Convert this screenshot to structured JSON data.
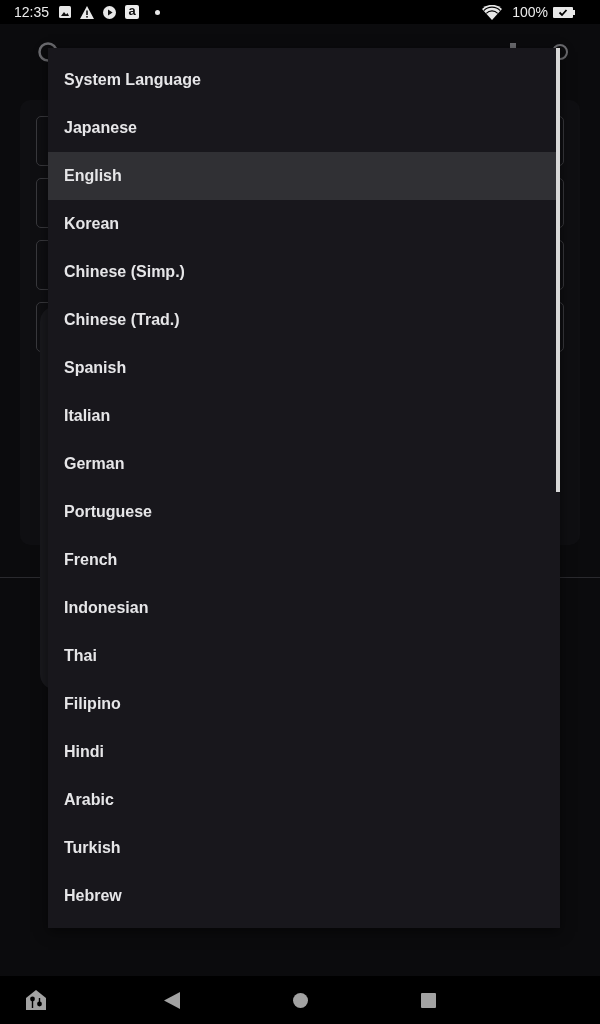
{
  "status_bar": {
    "time": "12:35",
    "app_badge": "a",
    "battery": "100%"
  },
  "language_menu": {
    "items": [
      {
        "label": "System Language",
        "selected": false
      },
      {
        "label": "Japanese",
        "selected": false
      },
      {
        "label": "English",
        "selected": true
      },
      {
        "label": "Korean",
        "selected": false
      },
      {
        "label": "Chinese (Simp.)",
        "selected": false
      },
      {
        "label": "Chinese (Trad.)",
        "selected": false
      },
      {
        "label": "Spanish",
        "selected": false
      },
      {
        "label": "Italian",
        "selected": false
      },
      {
        "label": "German",
        "selected": false
      },
      {
        "label": "Portuguese",
        "selected": false
      },
      {
        "label": "French",
        "selected": false
      },
      {
        "label": "Indonesian",
        "selected": false
      },
      {
        "label": "Thai",
        "selected": false
      },
      {
        "label": "Filipino",
        "selected": false
      },
      {
        "label": "Hindi",
        "selected": false
      },
      {
        "label": "Arabic",
        "selected": false
      },
      {
        "label": "Turkish",
        "selected": false
      },
      {
        "label": "Hebrew",
        "selected": false
      }
    ]
  }
}
